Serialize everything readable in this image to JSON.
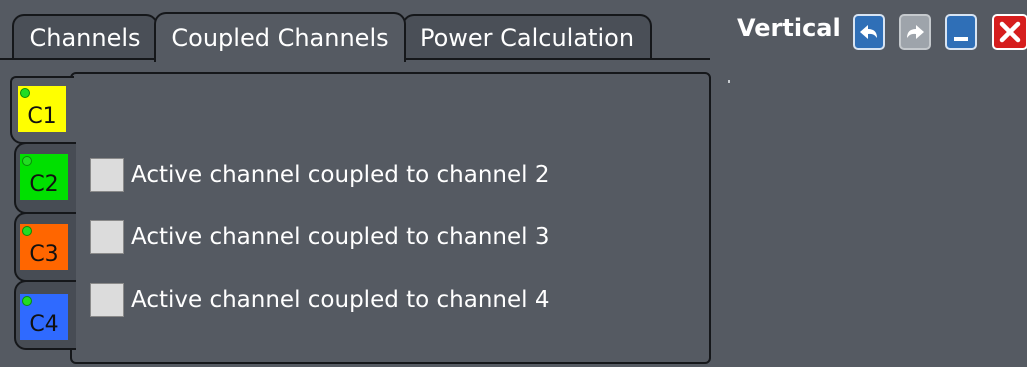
{
  "window": {
    "title": "Vertical"
  },
  "toolbar": {
    "undo_icon": "undo-arrow-icon",
    "redo_icon": "redo-arrow-icon",
    "minimize_icon": "minimize-icon",
    "close_icon": "close-icon"
  },
  "tabs": [
    {
      "label": "Channels",
      "active": false
    },
    {
      "label": "Coupled Channels",
      "active": true
    },
    {
      "label": "Power Calculation",
      "active": false
    }
  ],
  "channel_tabs": [
    {
      "label": "C1",
      "color": "#ffff00",
      "active": true
    },
    {
      "label": "C2",
      "color": "#00e000",
      "active": false
    },
    {
      "label": "C3",
      "color": "#ff6600",
      "active": false
    },
    {
      "label": "C4",
      "color": "#2f6aff",
      "active": false
    }
  ],
  "coupling": [
    {
      "label": "Active channel coupled to channel 2",
      "checked": false
    },
    {
      "label": "Active channel coupled to channel 3",
      "checked": false
    },
    {
      "label": "Active channel coupled to channel 4",
      "checked": false
    }
  ],
  "colors": {
    "background": "#555a62",
    "tab_inactive": "#4a4f57",
    "border": "#15171a",
    "button_blue": "#2f6fb7",
    "close_red": "#d61e1e",
    "indicator_green": "#22dd22"
  }
}
